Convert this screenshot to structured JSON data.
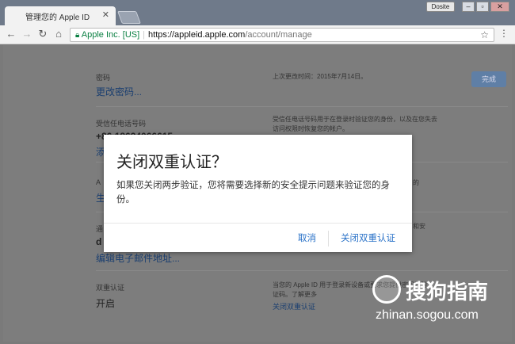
{
  "browser": {
    "tab_title": "管理您的 Apple ID",
    "user_chip": "Dosite",
    "url_cert": "Apple Inc. [US]",
    "url_host": "https://appleid.apple.com",
    "url_path": "/account/manage"
  },
  "page": {
    "password": {
      "label": "密码",
      "link": "更改密码...",
      "desc": "上次更改时间：2015年7月14日。",
      "done": "完成"
    },
    "phone": {
      "label": "受信任电话号码",
      "value": "+86 18634066615",
      "link": "添",
      "desc": "受信任电话号码用于在登录时验证您的身份，以及在您失去访问权限时恢复您的帐户。"
    },
    "section3": {
      "label": "A",
      "link": "生",
      "desc_tail": "的"
    },
    "email": {
      "label": "通",
      "value": "d",
      "link": "编辑电子邮件地址...",
      "desc_tail": "和安"
    },
    "twofactor": {
      "label": "双重认证",
      "value": "开启",
      "desc": "当您的 Apple ID 用于登录新设备或要求您提供密码和验证码。了解更多",
      "link": "关闭双重认证"
    }
  },
  "modal": {
    "title": "关闭双重认证？",
    "body": "如果您关闭两步验证，您将需要选择新的安全提示问题来验证您的身份。",
    "cancel": "取消",
    "confirm": "关闭双重认证"
  },
  "watermark": {
    "brand": "搜狗指南",
    "url": "zhinan.sogou.com"
  }
}
